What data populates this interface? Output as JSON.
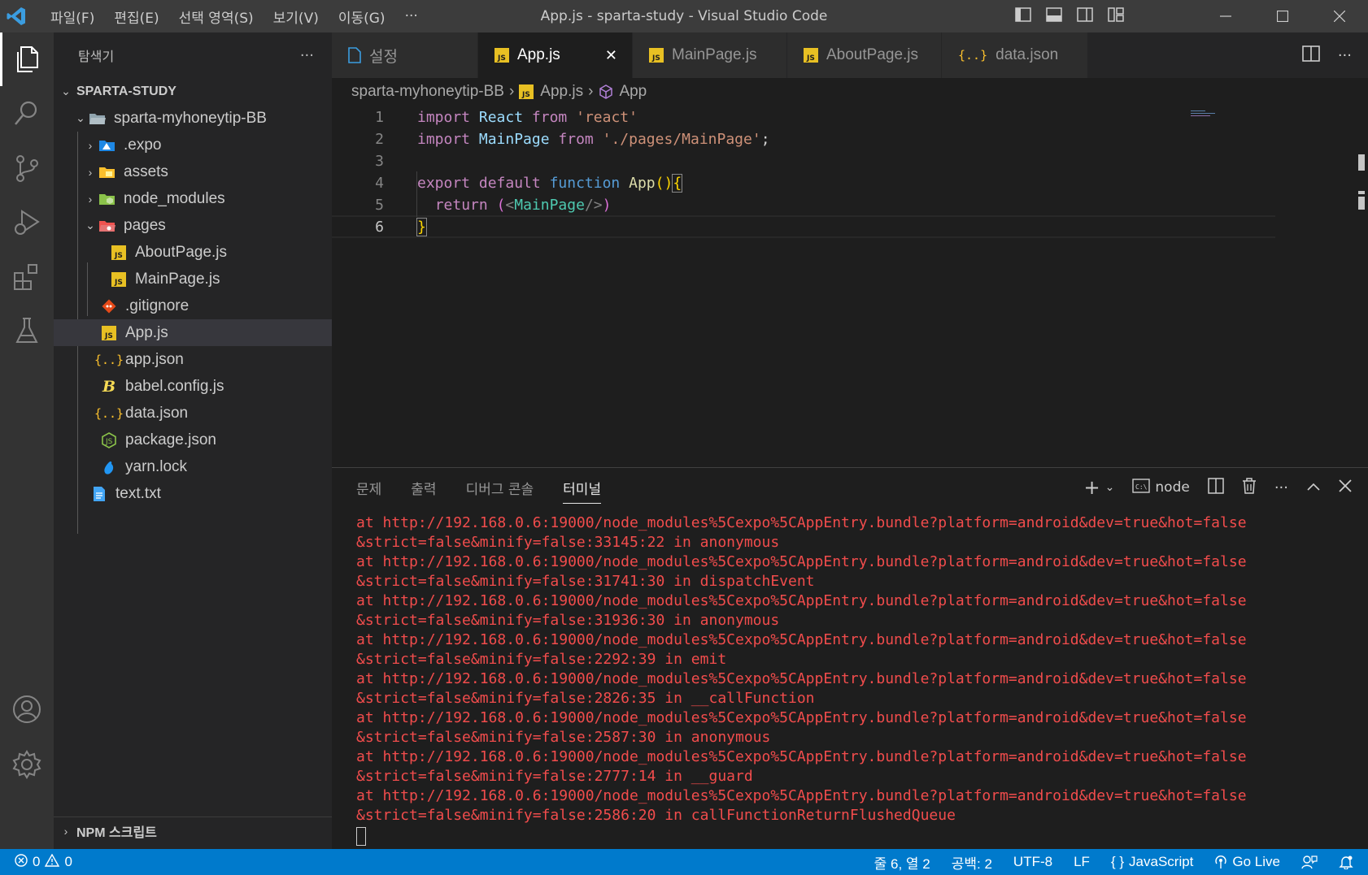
{
  "window": {
    "title": "App.js - sparta-study - Visual Studio Code",
    "menu": [
      "파일(F)",
      "편집(E)",
      "선택 영역(S)",
      "보기(V)",
      "이동(G)",
      "···"
    ]
  },
  "sidebar": {
    "title": "탐색기",
    "more": "···",
    "workspace": "SPARTA-STUDY",
    "tree": [
      {
        "label": "sparta-myhoneytip-BB",
        "type": "folder-open",
        "icon": "folder-icon"
      },
      {
        "label": ".expo",
        "type": "folder",
        "icon": "expo-folder-icon"
      },
      {
        "label": "assets",
        "type": "folder",
        "icon": "assets-folder-icon"
      },
      {
        "label": "node_modules",
        "type": "folder",
        "icon": "node-folder-icon"
      },
      {
        "label": "pages",
        "type": "folder-open",
        "icon": "pages-folder-icon"
      },
      {
        "label": "AboutPage.js",
        "type": "file",
        "icon": "js-file-icon"
      },
      {
        "label": "MainPage.js",
        "type": "file",
        "icon": "js-file-icon"
      },
      {
        "label": ".gitignore",
        "type": "file",
        "icon": "git-icon"
      },
      {
        "label": "App.js",
        "type": "file",
        "icon": "js-file-icon"
      },
      {
        "label": "app.json",
        "type": "file",
        "icon": "json-icon"
      },
      {
        "label": "babel.config.js",
        "type": "file",
        "icon": "babel-icon"
      },
      {
        "label": "data.json",
        "type": "file",
        "icon": "json-icon"
      },
      {
        "label": "package.json",
        "type": "file",
        "icon": "npm-package-icon"
      },
      {
        "label": "yarn.lock",
        "type": "file",
        "icon": "yarn-icon"
      },
      {
        "label": "text.txt",
        "type": "file",
        "icon": "text-file-icon"
      }
    ],
    "npm_section": "NPM 스크립트"
  },
  "tabs": [
    {
      "label": "설정",
      "icon": "settings-file-icon"
    },
    {
      "label": "App.js",
      "icon": "js-file-icon",
      "active": true,
      "close": "✕"
    },
    {
      "label": "MainPage.js",
      "icon": "js-file-icon"
    },
    {
      "label": "AboutPage.js",
      "icon": "js-file-icon"
    },
    {
      "label": "data.json",
      "icon": "json-icon"
    }
  ],
  "breadcrumb": [
    "sparta-myhoneytip-BB",
    "App.js",
    "App"
  ],
  "editor": {
    "line_numbers": [
      "1",
      "2",
      "3",
      "4",
      "5",
      "6"
    ],
    "lines": {
      "l1": {
        "kw": "import",
        "id": "React",
        "kw2": "from",
        "str": "'react'"
      },
      "l2": {
        "kw": "import",
        "id": "MainPage",
        "kw2": "from",
        "str": "'./pages/MainPage'",
        "semi": ";"
      },
      "l4": {
        "kw": "export",
        "kw2": "default",
        "kw3": "function",
        "fn": "App",
        "parens": "()",
        "brace": "{"
      },
      "l5": {
        "kw": "return",
        "open": "(",
        "lt": "<",
        "tag": "MainPage",
        "close_tag": "/>",
        "close": ")"
      },
      "l6": {
        "brace": "}"
      }
    }
  },
  "panel": {
    "tabs": [
      "문제",
      "출력",
      "디버그 콘솔",
      "터미널"
    ],
    "active_tab": "터미널",
    "terminal_name": "node",
    "terminal_lines": [
      "at http://192.168.0.6:19000/node_modules%5Cexpo%5CAppEntry.bundle?platform=android&dev=true&hot=false",
      "&strict=false&minify=false:33145:22 in anonymous",
      "at http://192.168.0.6:19000/node_modules%5Cexpo%5CAppEntry.bundle?platform=android&dev=true&hot=false",
      "&strict=false&minify=false:31741:30 in dispatchEvent",
      "at http://192.168.0.6:19000/node_modules%5Cexpo%5CAppEntry.bundle?platform=android&dev=true&hot=false",
      "&strict=false&minify=false:31936:30 in anonymous",
      "at http://192.168.0.6:19000/node_modules%5Cexpo%5CAppEntry.bundle?platform=android&dev=true&hot=false",
      "&strict=false&minify=false:2292:39 in emit",
      "at http://192.168.0.6:19000/node_modules%5Cexpo%5CAppEntry.bundle?platform=android&dev=true&hot=false",
      "&strict=false&minify=false:2826:35 in __callFunction",
      "at http://192.168.0.6:19000/node_modules%5Cexpo%5CAppEntry.bundle?platform=android&dev=true&hot=false",
      "&strict=false&minify=false:2587:30 in anonymous",
      "at http://192.168.0.6:19000/node_modules%5Cexpo%5CAppEntry.bundle?platform=android&dev=true&hot=false",
      "&strict=false&minify=false:2777:14 in __guard",
      "at http://192.168.0.6:19000/node_modules%5Cexpo%5CAppEntry.bundle?platform=android&dev=true&hot=false",
      "&strict=false&minify=false:2586:20 in callFunctionReturnFlushedQueue"
    ]
  },
  "statusbar": {
    "errors": "0",
    "warnings": "0",
    "position": "줄 6, 열 2",
    "indent": "공백: 2",
    "encoding": "UTF-8",
    "eol": "LF",
    "language": "JavaScript",
    "golive": "Go Live"
  },
  "colors": {
    "accent": "#007acc",
    "terminal_error": "#f14c4c",
    "js_icon": "#e8c023"
  }
}
